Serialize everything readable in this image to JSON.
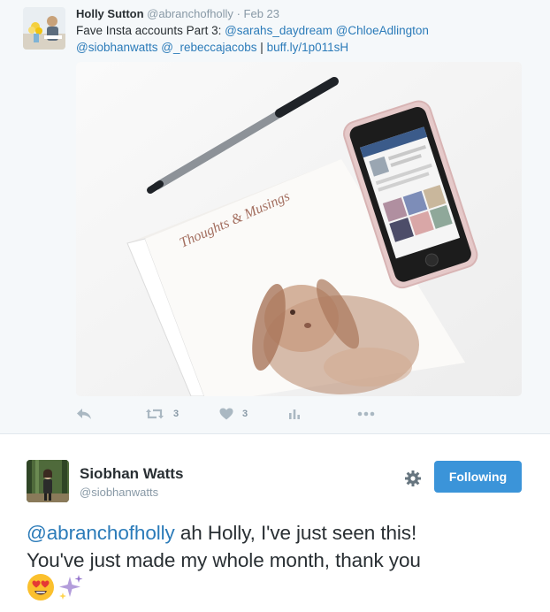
{
  "first_tweet": {
    "author_name": "Holly Sutton",
    "author_handle": "@abranchofholly",
    "separator": "·",
    "date": "Feb 23",
    "text_prefix": "Fave Insta accounts Part 3: ",
    "mentions_line1": [
      "@sarahs_daydream",
      "@ChloeAdlington"
    ],
    "mentions_line2": [
      "@siobhanwatts",
      "@_rebeccajacobs"
    ],
    "pipe": " | ",
    "link": "buff.ly/1p011sH",
    "photo_notebook_title": "Thoughts & Musings",
    "actions": {
      "reply_icon": "reply-icon",
      "retweet_icon": "retweet-icon",
      "retweet_count": "3",
      "like_icon": "heart-icon",
      "like_count": "3",
      "analytics_icon": "analytics-icon",
      "more_icon": "more-icon"
    }
  },
  "reply_tweet": {
    "author_name": "Siobhan Watts",
    "author_handle": "@siobhanwatts",
    "settings_icon": "gear-icon",
    "follow_button_label": "Following",
    "mention": "@abranchofholly",
    "text_line1": " ah Holly, I've just seen this!",
    "text_line2": "You've just made my whole month, thank you",
    "emojis": [
      "heart-eyes-emoji",
      "sparkles-emoji"
    ]
  },
  "colors": {
    "link": "#2b7bb9",
    "follow_button": "#3b94d9",
    "muted": "#8899a6",
    "action_icons": "#aab8c2",
    "top_background": "#f5f8fa"
  }
}
